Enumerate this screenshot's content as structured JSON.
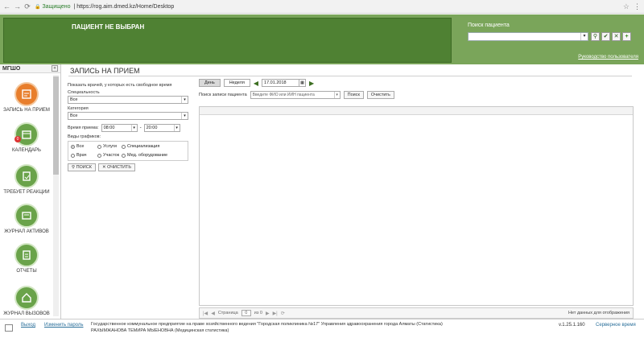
{
  "browser": {
    "secure_label": "Защищено",
    "url": "https://rog.aim.dmed.kz/Home/Desktop"
  },
  "header": {
    "patient_status": "ПАЦИЕНТ НЕ ВЫБРАН",
    "search_title": "Поиск пациента",
    "user_link": "Руководство пользователя"
  },
  "sidebar": {
    "title": "МГШО",
    "items": [
      {
        "label": "ЗАПИСЬ НА ПРИЕМ",
        "icon": "calendar-edit-icon",
        "active": true
      },
      {
        "label": "КАЛЕНДАРЬ",
        "icon": "calendar-icon",
        "badge": "0"
      },
      {
        "label": "ТРЕБУЕТ РЕАКЦИИ",
        "icon": "task-icon"
      },
      {
        "label": "ЖУРНАЛ АКТИВОВ",
        "icon": "journal-icon"
      },
      {
        "label": "ОТЧЕТЫ",
        "icon": "report-icon"
      },
      {
        "label": "ЖУРНАЛ ВЫЗОВОВ",
        "icon": "house-call-icon"
      }
    ]
  },
  "content": {
    "title": "ЗАПИСЬ НА ПРИЕМ",
    "filters": {
      "hint": "Показать врачей, у которых есть свободное время",
      "specialty_label": "Специальность",
      "specialty_value": "Все",
      "category_label": "Категория",
      "category_value": "Все",
      "time_label": "Время приема:",
      "time_from": "08:00",
      "time_to": "20:00",
      "types_label": "Виды графиков:",
      "types": [
        {
          "label": "Все",
          "checked": true
        },
        {
          "label": "Услуги",
          "checked": false
        },
        {
          "label": "Специализация",
          "checked": false
        },
        {
          "label": "Врач",
          "checked": false
        },
        {
          "label": "Участок",
          "checked": false
        },
        {
          "label": "Мед. оборудование",
          "checked": false
        }
      ],
      "search_button": "ПОИСК",
      "clear_button": "ОЧИСТИТЬ"
    },
    "schedule": {
      "tab_day": "День",
      "tab_week": "Неделя",
      "date": "17.01.2018",
      "patient_label": "Поиск записи пациента",
      "patient_placeholder": "Введите ФИО или ИИН пациента",
      "search_btn": "Поиск",
      "clear_btn": "Очистить",
      "page_label": "Страница",
      "page_value": "0",
      "of_label": "из 0",
      "empty_label": "Нет данных для отображения"
    }
  },
  "footer": {
    "exit": "Выход",
    "change_password": "Изменить пароль",
    "org": "Государственное коммунальное предприятие на праве хозяйственного ведения \"Городская поликлиника №17\" Управления здравоохранения города Алматы (Статистика)",
    "user": "РАХЫМЖАНОВА ТЕМИРА МЫЕНОВНА (Медицинская статистика)",
    "version": "v.1.25.1.160",
    "server": "Серверное время"
  }
}
